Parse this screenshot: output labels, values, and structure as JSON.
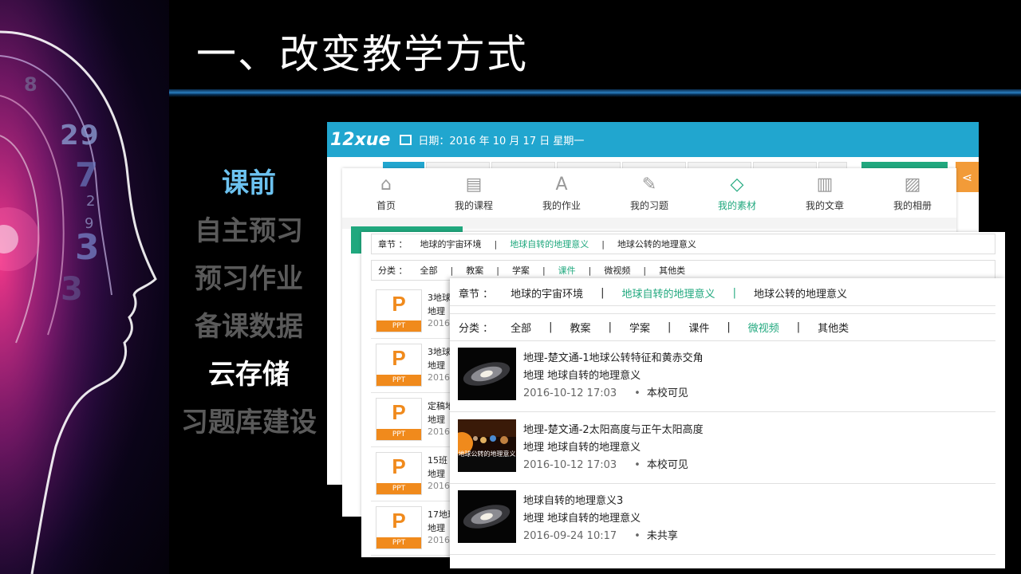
{
  "slide": {
    "title": "一、改变教学方式"
  },
  "menu": [
    {
      "label": "课前",
      "style": "active"
    },
    {
      "label": "自主预习",
      "style": "dim"
    },
    {
      "label": "预习作业",
      "style": "dim"
    },
    {
      "label": "备课数据",
      "style": "dim"
    },
    {
      "label": "云存储",
      "style": "white"
    },
    {
      "label": "习题库建设",
      "style": "dim"
    }
  ],
  "art_digits": [
    "8",
    "2",
    "9",
    "7",
    "2",
    "9",
    "3",
    "3"
  ],
  "panel1": {
    "logo": "12xue",
    "date": "日期：2016 年 10 月 17 日 星期一",
    "share_icon": "share-icon"
  },
  "nav": [
    {
      "label": "首页",
      "icon": "⌂",
      "active": false
    },
    {
      "label": "我的课程",
      "icon": "▤",
      "active": false
    },
    {
      "label": "我的作业",
      "icon": "A",
      "active": false
    },
    {
      "label": "我的习题",
      "icon": "✎",
      "active": false
    },
    {
      "label": "我的素材",
      "icon": "◇",
      "active": true
    },
    {
      "label": "我的文章",
      "icon": "▥",
      "active": false
    },
    {
      "label": "我的相册",
      "icon": "▨",
      "active": false
    }
  ],
  "panel3": {
    "chapter_label": "章节 ：",
    "chapters": [
      "地球的宇宙环境",
      "地球自转的地理意义",
      "地球公转的地理意义"
    ],
    "category_label": "分类 ：",
    "categories": [
      "全部",
      "教案",
      "学案",
      "课件",
      "微视频",
      "其他类"
    ],
    "items": [
      {
        "l1": "3地球",
        "l2": "地理 ",
        "l3": "2016",
        "badge": "PPT"
      },
      {
        "l1": "3地球",
        "l2": "地理 ",
        "l3": "2016",
        "badge": "PPT"
      },
      {
        "l1": "定稿地",
        "l2": "地理 ",
        "l3": "2016",
        "badge": "PPT"
      },
      {
        "l1": "15班",
        "l2": "地理 ",
        "l3": "2016",
        "badge": "PPT"
      },
      {
        "l1": "17地球",
        "l2": "地理 ",
        "l3": "2016",
        "badge": "PPT"
      }
    ],
    "ppt_letter": "P"
  },
  "panel4": {
    "chapter_label": "章节 ：",
    "chapters": [
      "地球的宇宙环境",
      "地球自转的地理意义",
      "地球公转的地理意义"
    ],
    "category_label": "分类 ：",
    "categories": [
      "全部",
      "教案",
      "学案",
      "课件",
      "微视频",
      "其他类"
    ],
    "items": [
      {
        "title": "地理-楚文通-1地球公转特征和黄赤交角",
        "subject": "地理 地球自转的地理意义",
        "date": "2016-10-12 17:03",
        "visibility": "本校可见",
        "thumb": "galaxy"
      },
      {
        "title": "地理-楚文通-2太阳高度与正午太阳高度",
        "subject": "地理 地球自转的地理意义",
        "date": "2016-10-12 17:03",
        "visibility": "本校可见",
        "thumb": "solar",
        "thumb_caption": "地球公转的地理意义"
      },
      {
        "title": "地球自转的地理意义3",
        "subject": "地理 地球自转的地理意义",
        "date": "2016-09-24 10:17",
        "visibility": "未共享",
        "thumb": "galaxy"
      }
    ]
  },
  "colors": {
    "accent_blue": "#21a6cf",
    "green": "#20a87e",
    "orange": "#f08a1c",
    "menu_active": "#6cc2f0"
  }
}
